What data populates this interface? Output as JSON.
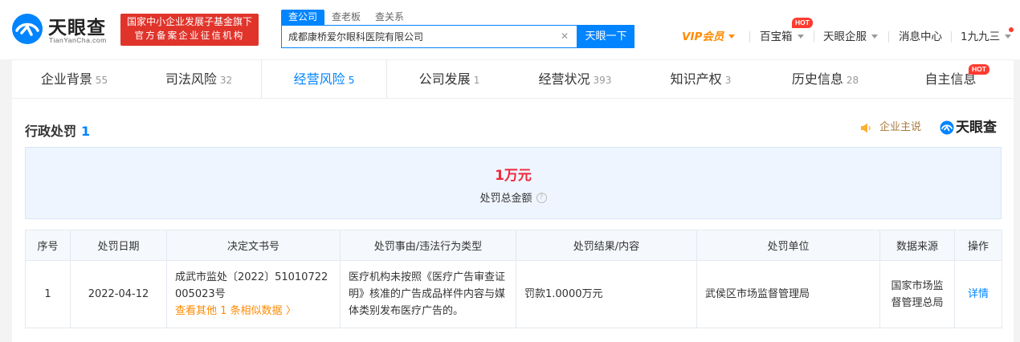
{
  "header": {
    "logo_cn": "天眼查",
    "logo_en": "TianYanCha.com",
    "gov_line1": "国家中小企业发展子基金旗下",
    "gov_line2": "官方备案企业征信机构",
    "search_tabs": [
      "查公司",
      "查老板",
      "查关系"
    ],
    "search_value": "成都康桥爱尔眼科医院有限公司",
    "search_button": "天眼一下",
    "vip": "VIP会员",
    "baibaoxiang": "百宝箱",
    "hot": "HOT",
    "qifu": "天眼企服",
    "messages": "消息中心",
    "user": "1九九三"
  },
  "tabs": [
    {
      "label": "企业背景",
      "count": "55"
    },
    {
      "label": "司法风险",
      "count": "32"
    },
    {
      "label": "经营风险",
      "count": "5"
    },
    {
      "label": "公司发展",
      "count": "1"
    },
    {
      "label": "经营状况",
      "count": "393"
    },
    {
      "label": "知识产权",
      "count": "3"
    },
    {
      "label": "历史信息",
      "count": "28"
    },
    {
      "label": "自主信息",
      "count": ""
    }
  ],
  "tab_hot": "HOT",
  "section": {
    "title": "行政处罚",
    "count": "1",
    "qiye_zhushuo": "企业主说",
    "brand": "天眼查"
  },
  "summary": {
    "amount": "1万元",
    "label": "处罚总金额"
  },
  "table": {
    "headers": [
      "序号",
      "处罚日期",
      "决定文书号",
      "处罚事由/违法行为类型",
      "处罚结果/内容",
      "处罚单位",
      "数据来源",
      "操作"
    ],
    "row": {
      "index": "1",
      "date": "2022-04-12",
      "doc_no": "成武市监处〔2022〕51010722005023号",
      "more_link": "查看其他 1 条相似数据",
      "reason": "医疗机构未按照《医疗广告审查证明》核准的广告成品样件内容与媒体类别发布医疗广告的。",
      "result": "罚款1.0000万元",
      "unit": "武侯区市场监督管理局",
      "source": "国家市场监督管理总局",
      "action": "详情"
    }
  },
  "colors": {
    "primary": "#0084ff",
    "red": "#e0342b",
    "orange": "#ff8a00",
    "amount": "#f0283c"
  }
}
